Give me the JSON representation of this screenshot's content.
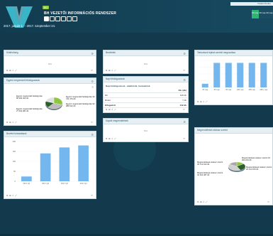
{
  "header": {
    "badge": "BIV",
    "brand": "BH VEZETŐI INFORMÁCIÓS RENDSZER",
    "date_range": "2017. január 1. – 2017. szeptember 24.",
    "user_label": "Pataki Pfeiffer",
    "tabs": [
      {
        "label": "90 nap",
        "active": true
      },
      {
        "label": "30 nap",
        "active": false
      },
      {
        "label": "30 nap",
        "active": false
      }
    ],
    "icons": [
      "chart-icon",
      "grid-icon",
      "clock-icon",
      "table-icon",
      "doc-icon",
      "tag-icon"
    ]
  },
  "panels": {
    "p1": {
      "title": "Kintlévőség",
      "empty": "N/A"
    },
    "p2": {
      "title": "Bevételek",
      "empty": "N/A"
    },
    "p3": {
      "title": "Tartozások lejárat szerinti megoszlása",
      "empty": "N/A"
    },
    "p4": {
      "title": "Egyéni megrendelt feldolgozások",
      "labels": [
        "Egyéni megrendelt feldolgozás 30 741 375 db",
        "Egyéni megrendelt feldolgozás 92 989 512 db",
        "Egyéni megrendelt feldolgozás 86 483 364 db",
        "Egyéni megrendelt feldolgozás 27 491 081 db"
      ]
    },
    "p5": {
      "title": "Napi feldolgozások",
      "subtitle": "Napi feldolgozások - adatkörök, tranzakciók",
      "headers": [
        "",
        "Db. (db)"
      ],
      "rows": [
        {
          "name": "Db",
          "value": "135 db"
        },
        {
          "name": "Bruttó",
          "value": "7 db"
        },
        {
          "name": "Elfogadott",
          "value": "142 db"
        }
      ]
    },
    "p6": {
      "title": "Kapott megrendelések",
      "empty": "N/A"
    },
    "p7": {
      "title": "Tartozások lejárat szerinti megoszlása",
      "x_labels": [
        "30 nap",
        "60 nap",
        "90 nap",
        "180 nap",
        "365 nap",
        "365+ nap"
      ]
    },
    "p8": {
      "title": "Megrendelések státusz szerint",
      "labels": [
        "Megrendelések státusz szerint 15 404 223 db",
        "Megrendelések státusz szerint 26 141 879 db",
        "Megrendelések státusz szerint 45 712 913 db",
        "Megrendelések státusz szerint 32 104 487 db"
      ]
    },
    "p9": {
      "title": "Bevétel kimutatások",
      "x_labels": [
        "2017 Q1",
        "2017 Q2",
        "2017 Q3",
        "2017 Q4"
      ],
      "y_labels": [
        "200",
        "150",
        "100",
        "50",
        "0"
      ]
    }
  },
  "footer_tools": [
    "⇅",
    "⊞",
    "⇩",
    "⤢",
    "⟳"
  ],
  "chart_data": [
    {
      "type": "bar",
      "title": "Tartozások lejárat szerinti megoszlása",
      "categories": [
        "30 nap",
        "60 nap",
        "90 nap",
        "180 nap",
        "365 nap",
        "365+ nap"
      ],
      "values": [
        15,
        100,
        100,
        100,
        100,
        100
      ],
      "ylim": [
        0,
        110
      ]
    },
    {
      "type": "bar",
      "title": "Bevétel kimutatások",
      "categories": [
        "2017 Q1",
        "2017 Q2",
        "2017 Q3",
        "2017 Q4"
      ],
      "values": [
        24,
        140,
        170,
        180
      ],
      "ylim": [
        0,
        200
      ]
    },
    {
      "type": "pie",
      "title": "Egyéni megrendelt feldolgozások",
      "values": [
        30,
        32,
        18,
        20
      ]
    },
    {
      "type": "pie",
      "title": "Megrendelések státusz szerint",
      "values": [
        15,
        28,
        40,
        17
      ]
    }
  ],
  "colors": {
    "accent": "#2bb673",
    "bar": "#74b7ef",
    "header": "#123b4f"
  }
}
